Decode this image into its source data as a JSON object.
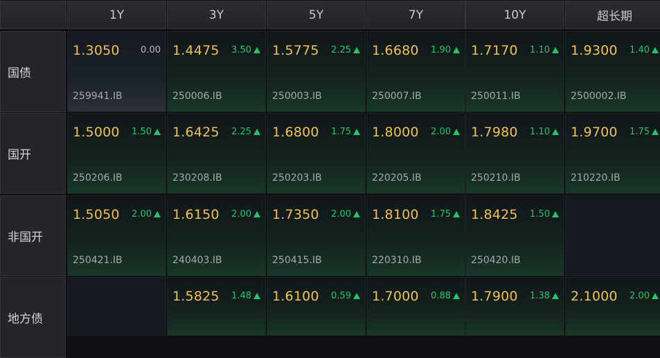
{
  "columns": [
    "1Y",
    "3Y",
    "5Y",
    "7Y",
    "10Y",
    "超长期"
  ],
  "rows": [
    {
      "label": "国债",
      "cells": [
        {
          "rate": "1.3050",
          "change": "0.00",
          "direction": "flat",
          "code": "259941.IB"
        },
        {
          "rate": "1.4475",
          "change": "3.50",
          "direction": "up",
          "code": "250006.IB"
        },
        {
          "rate": "1.5775",
          "change": "2.25",
          "direction": "up",
          "code": "250003.IB"
        },
        {
          "rate": "1.6680",
          "change": "1.90",
          "direction": "up",
          "code": "250007.IB"
        },
        {
          "rate": "1.7170",
          "change": "1.10",
          "direction": "up",
          "code": "250011.IB"
        },
        {
          "rate": "1.9300",
          "change": "1.40",
          "direction": "up",
          "code": "2500002.IB"
        }
      ]
    },
    {
      "label": "国开",
      "cells": [
        {
          "rate": "1.5000",
          "change": "1.50",
          "direction": "up",
          "code": "250206.IB"
        },
        {
          "rate": "1.6425",
          "change": "2.25",
          "direction": "up",
          "code": "230208.IB"
        },
        {
          "rate": "1.6800",
          "change": "1.75",
          "direction": "up",
          "code": "250203.IB"
        },
        {
          "rate": "1.8000",
          "change": "2.00",
          "direction": "up",
          "code": "220205.IB"
        },
        {
          "rate": "1.7980",
          "change": "1.10",
          "direction": "up",
          "code": "250210.IB"
        },
        {
          "rate": "1.9700",
          "change": "1.75",
          "direction": "up",
          "code": "210220.IB"
        }
      ]
    },
    {
      "label": "非国开",
      "cells": [
        {
          "rate": "1.5050",
          "change": "2.00",
          "direction": "up",
          "code": "250421.IB"
        },
        {
          "rate": "1.6150",
          "change": "2.00",
          "direction": "up",
          "code": "240403.IB"
        },
        {
          "rate": "1.7350",
          "change": "2.00",
          "direction": "up",
          "code": "250415.IB"
        },
        {
          "rate": "1.8100",
          "change": "1.75",
          "direction": "up",
          "code": "220310.IB"
        },
        {
          "rate": "1.8425",
          "change": "1.50",
          "direction": "up",
          "code": "250420.IB"
        },
        null
      ]
    },
    {
      "label": "地方债",
      "cells": [
        null,
        {
          "rate": "1.5825",
          "change": "1.48",
          "direction": "up",
          "code": ""
        },
        {
          "rate": "1.6100",
          "change": "0.59",
          "direction": "up",
          "code": ""
        },
        {
          "rate": "1.7000",
          "change": "0.88",
          "direction": "up",
          "code": ""
        },
        {
          "rate": "1.7900",
          "change": "1.38",
          "direction": "up",
          "code": ""
        },
        {
          "rate": "2.1000",
          "change": "2.00",
          "direction": "up",
          "code": ""
        }
      ]
    }
  ],
  "colors": {
    "rate": "#f3c052",
    "up": "#27c46a",
    "flat": "#b8bcc2"
  }
}
